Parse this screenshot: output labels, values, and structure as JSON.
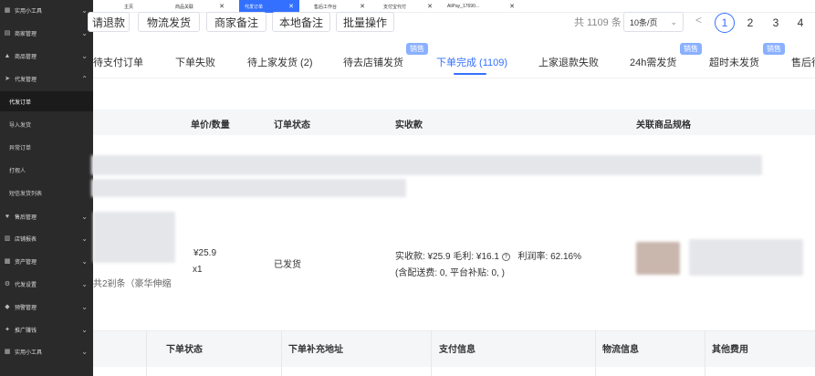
{
  "sidebar": {
    "items": [
      {
        "icon": "grid-icon",
        "label": "实用小工具",
        "y": 0
      },
      {
        "icon": "cube-icon",
        "label": "商家管理",
        "y": 26
      },
      {
        "icon": "shop-icon",
        "label": "商品管理",
        "y": 50
      },
      {
        "icon": "send-icon",
        "label": "代发管理",
        "y": 75
      }
    ],
    "subitems": [
      "代发订单",
      "导入发货",
      "异常订单",
      "打假人",
      "短信发货列表"
    ],
    "items_bottom": [
      {
        "icon": "heart-icon",
        "label": "售后管理"
      },
      {
        "icon": "chart-icon",
        "label": "店铺报表"
      },
      {
        "icon": "asset-icon",
        "label": "资产管理"
      },
      {
        "icon": "gear-icon",
        "label": "代发设置"
      },
      {
        "icon": "bell-icon",
        "label": "预警管理"
      },
      {
        "icon": "promo-icon",
        "label": "推广赚钱"
      },
      {
        "icon": "grid-icon",
        "label": "实用小工具"
      }
    ]
  },
  "tabs": [
    {
      "label": "主页"
    },
    {
      "label": "商品关联"
    },
    {
      "label": "代发订单"
    },
    {
      "label": "售后工作台"
    },
    {
      "label": "支付宝代付"
    },
    {
      "label": "AliPay_17690..."
    }
  ],
  "actions": {
    "refund": "请退款",
    "logistics": "物流发货",
    "merchant_note": "商家备注",
    "local_note": "本地备注",
    "batch": "批量操作"
  },
  "pagination": {
    "total": "共 1109 条",
    "page_size": "10条/页",
    "prev": "<",
    "pages": [
      "1",
      "2",
      "3",
      "4"
    ]
  },
  "status_tabs": {
    "pending_pay": "待支付订单",
    "order_fail": "下单失败",
    "await_ship": "待上家发货 (2)",
    "to_store": "待去店铺发货",
    "done": "下单完成 (1109)",
    "refund_fail": "上家退款失败",
    "h24": "24h需发货",
    "overdue": "超时未发货",
    "after": "售后待",
    "badge": "销售"
  },
  "table": {
    "headers": {
      "price_qty": "单价/数量",
      "status": "订单状态",
      "paid": "实收款",
      "spec": "关联商品规格"
    },
    "row": {
      "price": "¥25.9",
      "qty": "x1",
      "status": "已发货",
      "paid_detail": "实收款: ¥25.9   毛利: ¥16.1",
      "profit_rate": "利润率: 62.16%",
      "shipping_note": "(含配送费: 0, 平台补贴: 0, )",
      "spec_suffix": "共2剎条（豪华伸缩"
    }
  },
  "bottom_headers": {
    "order_status": "下单状态",
    "address": "下单补充地址",
    "payment": "支付信息",
    "logistics": "物流信息",
    "fees": "其他费用"
  }
}
